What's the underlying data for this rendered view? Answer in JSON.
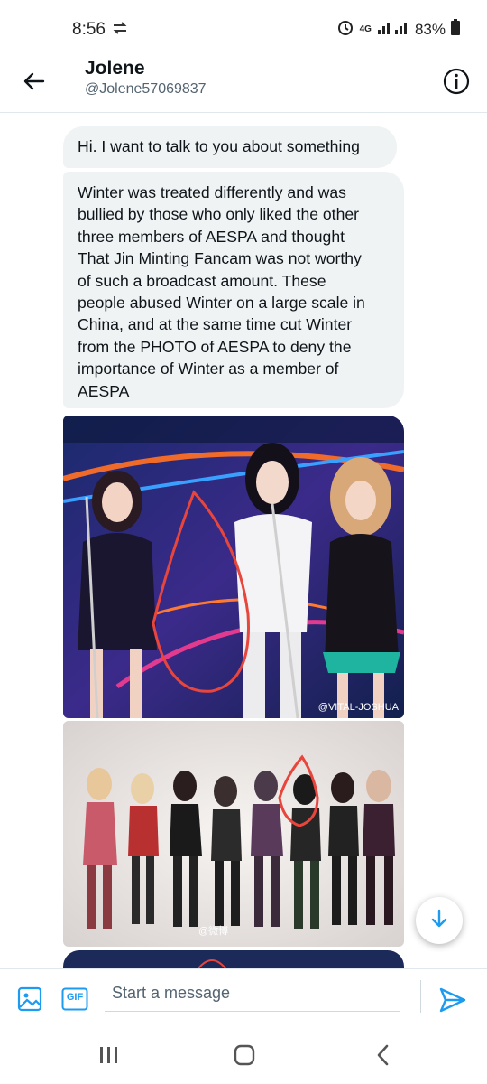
{
  "status_bar": {
    "time": "8:56",
    "network": "4G",
    "battery": "83%",
    "icons": [
      "sync-icon",
      "alarm-icon",
      "signal-icon",
      "battery-icon"
    ]
  },
  "header": {
    "name": "Jolene",
    "handle": "@Jolene57069837"
  },
  "messages": [
    {
      "text": "Hi. I want to talk to you about something"
    },
    {
      "text": "Winter was treated differently and was\nbullied by those who only liked the other\nthree members of AESPA and thought\nThat Jin Minting Fancam was not worthy\nof such a broadcast amount. These\npeople abused Winter on a large scale in\nChina, and at the same time cut Winter\nfrom the PHOTO of AESPA to deny the\nimportance of Winter as a member of\nAESPA"
    }
  ],
  "photos": [
    {
      "watermark": "@VITAL-JOSHUA"
    },
    {
      "watermark": "@微博"
    }
  ],
  "composer": {
    "placeholder": "Start a message",
    "gif_label": "GIF"
  },
  "colors": {
    "accent": "#1d9bf0",
    "bubble": "#eff3f4",
    "annotation": "#e8453c"
  }
}
